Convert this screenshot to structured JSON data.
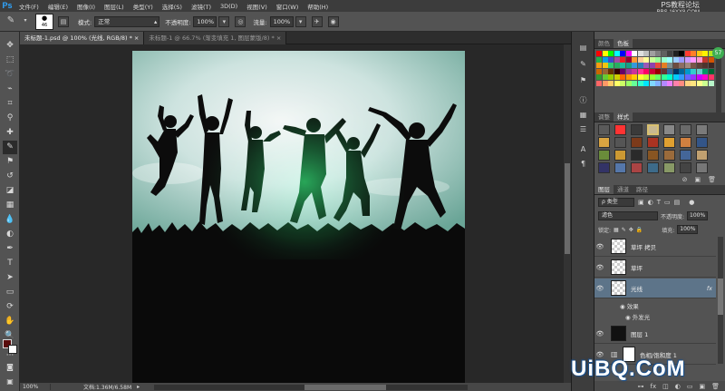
{
  "app": {
    "logo": "Ps"
  },
  "menu": [
    "文件(F)",
    "编辑(E)",
    "图像(I)",
    "图层(L)",
    "类型(Y)",
    "选择(S)",
    "滤镜(T)",
    "3D(D)",
    "视图(V)",
    "窗口(W)",
    "帮助(H)"
  ],
  "watermark": {
    "line1": "PS教程论坛",
    "line2": "BBS.16XX8.COM"
  },
  "options": {
    "brush_size": "46",
    "mode_label": "模式:",
    "mode_value": "正常",
    "opacity_label": "不透明度:",
    "opacity_value": "100%",
    "flow_label": "流量:",
    "flow_value": "100%"
  },
  "tabs": [
    {
      "label": "未标题-1.psd @ 100% (光线, RGB/8) *",
      "close": "×"
    },
    {
      "label": "未标题-1 @ 66.7% (渐变填充 1, 图层蒙版/8) *",
      "close": "×"
    }
  ],
  "status": {
    "zoom": "100%",
    "doc": "文档:1.36M/6.58M",
    "arrow": "▸"
  },
  "swatches_panel": {
    "tabs": [
      "颜色",
      "色板"
    ],
    "colors": [
      "#ff0000",
      "#ffff00",
      "#00ff00",
      "#00ffff",
      "#0000ff",
      "#ff00ff",
      "#ffffff",
      "#e0e0e0",
      "#c0c0c0",
      "#a0a0a0",
      "#808080",
      "#606060",
      "#404040",
      "#202020",
      "#000000",
      "#ff3b30",
      "#ff7f27",
      "#ffc90e",
      "#fff200",
      "#b5e61d",
      "#22b14c",
      "#00a2e8",
      "#3f48cc",
      "#a349a4",
      "#ed1c24",
      "#990030",
      "#ff9933",
      "#ffcc99",
      "#ffff99",
      "#ccff99",
      "#99ff99",
      "#99ffcc",
      "#99ffff",
      "#99ccff",
      "#9999ff",
      "#cc99ff",
      "#ff99ff",
      "#ff99cc",
      "#c0392b",
      "#d35400",
      "#f39c12",
      "#f1c40f",
      "#2ecc71",
      "#27ae60",
      "#1abc9c",
      "#16a085",
      "#3498db",
      "#2980b9",
      "#9b59b6",
      "#8e44ad",
      "#e74c3c",
      "#e67e22",
      "#7f8c8d",
      "#6d4c41",
      "#8d6e63",
      "#a1887f",
      "#795548",
      "#5d4037",
      "#4e342e",
      "#3e2723",
      "#cc6600",
      "#996633",
      "#663300",
      "#330000",
      "#660066",
      "#993399",
      "#cc3399",
      "#ff3399",
      "#ff0066",
      "#cc0033",
      "#990000",
      "#663333",
      "#336699",
      "#003366",
      "#006699",
      "#0099cc",
      "#33cccc",
      "#66cccc",
      "#009966",
      "#006633",
      "#339933",
      "#66cc33",
      "#99cc00",
      "#cccc00",
      "#ff6600",
      "#ff9900",
      "#ffcc00",
      "#ffff33",
      "#ccff33",
      "#99ff33",
      "#66ff66",
      "#33ff99",
      "#00ffcc",
      "#00ccff",
      "#3399ff",
      "#6666ff",
      "#9933ff",
      "#cc00ff",
      "#ff00cc",
      "#ff3366",
      "#ff6666",
      "#ff9966",
      "#ffcc66",
      "#ffff66",
      "#ccff66",
      "#99ff66",
      "#66ff99",
      "#33ffcc",
      "#00e5ff",
      "#80d8ff",
      "#82b1ff",
      "#b388ff",
      "#ea80fc",
      "#ff80ab",
      "#ff8a80",
      "#ffd180",
      "#ffe57f",
      "#ffff8d",
      "#ccff90",
      "#b9f6ca"
    ]
  },
  "styles_panel": {
    "tabs": [
      "调整",
      "样式"
    ],
    "cells": [
      "#5a5a5a",
      "#ff3333",
      "#3a3a3a",
      "#c8b890",
      "#888888",
      "#6a6a6a",
      "#7a7a7a",
      "#d9a441",
      "#555555",
      "#7c3a1a",
      "#aa3322",
      "#e0a030",
      "#d08040",
      "#335588",
      "#6a8c3a",
      "#cc9933",
      "#2a2a2a",
      "#885522",
      "#9b6b3b",
      "#446699",
      "#c0a070",
      "#333366",
      "#5577aa",
      "#aa4444",
      "#3d6b8a",
      "#889966",
      "#444444",
      "#777777"
    ]
  },
  "layers_panel": {
    "tabs": [
      "图层",
      "通道",
      "路径"
    ],
    "filter_label": "类型",
    "blend_mode": "滤色",
    "opacity_label": "不透明度:",
    "opacity_value": "100%",
    "lock_label": "锁定:",
    "fill_label": "填充:",
    "fill_value": "100%",
    "layers": [
      {
        "name": "草坪 拷贝",
        "fx": ""
      },
      {
        "name": "草坪",
        "fx": ""
      },
      {
        "name": "光线",
        "fx": "fx"
      },
      {
        "name": "图层 1",
        "fx": ""
      },
      {
        "name": "色相/饱和度 1",
        "fx": ""
      }
    ],
    "effects_label": "效果",
    "outer_glow_label": "外发光"
  },
  "bottom_watermark": "UiBQ.CoM",
  "badge": "57"
}
